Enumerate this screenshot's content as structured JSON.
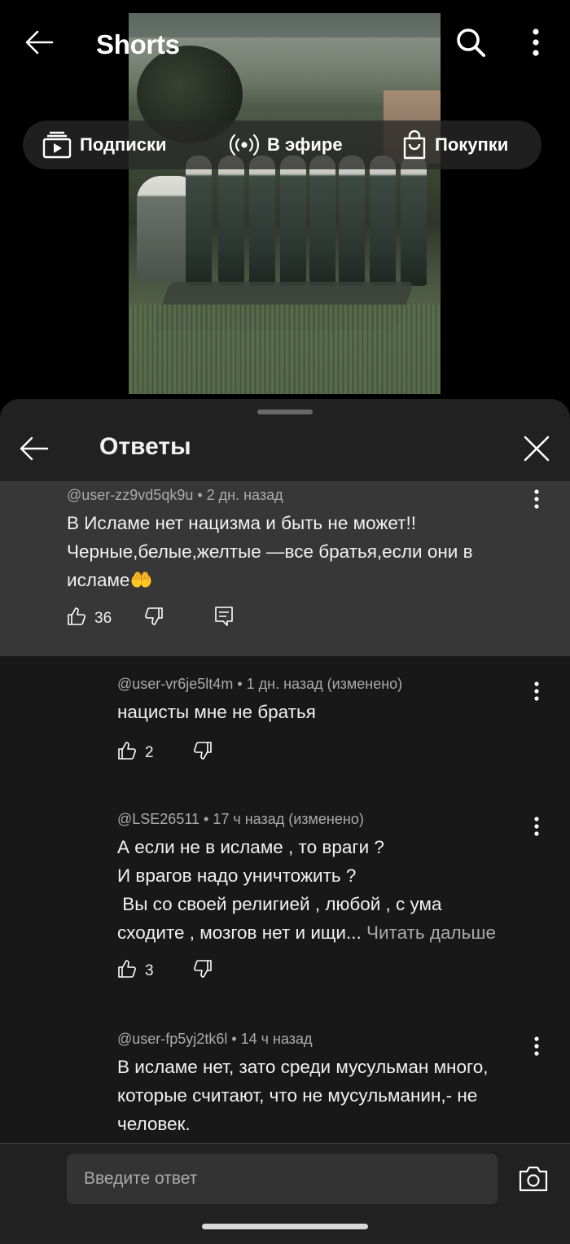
{
  "header": {
    "title": "Shorts",
    "back_icon": "arrow-back-icon",
    "search_icon": "search-icon",
    "more_icon": "more-vert-icon"
  },
  "chips": [
    {
      "label": "Подписки",
      "icon": "subscriptions-icon"
    },
    {
      "label": "В эфире",
      "icon": "live-icon"
    },
    {
      "label": "Покупки",
      "icon": "shopping-bag-icon"
    }
  ],
  "sheet": {
    "title": "Ответы",
    "back_icon": "arrow-back-icon",
    "close_icon": "close-icon"
  },
  "parent_comment": {
    "meta": "@user-zz9vd5qk9u • 2 дн. назад",
    "text": "В Исламе нет нацизма и быть не может!! Черные,белые,желтые —все братья,если они в исламе🤲",
    "likes": "36"
  },
  "replies": [
    {
      "meta": "@user-vr6je5lt4m • 1 дн. назад (изменено)",
      "text": "нацисты мне не братья",
      "likes": "2"
    },
    {
      "meta": "@LSE26511 • 17 ч назад (изменено)",
      "lines": [
        "А если не в исламе , то враги ?",
        "И врагов надо уничтожить ?",
        " Вы со своей религией , любой , с ума",
        "сходите , мозгов нет и ищи... "
      ],
      "read_more": "Читать дальше",
      "likes": "3"
    },
    {
      "meta": "@user-fp5yj2tk6l • 14 ч назад",
      "text": "В исламе нет, зато среди мусульман много, которые считают, что не мусульманин,- не человек."
    }
  ],
  "composer": {
    "placeholder": "Введите ответ",
    "camera_icon": "camera-icon"
  },
  "colors": {
    "background": "#000000",
    "sheet": "#212121",
    "highlight": "#373737",
    "list": "#181818",
    "text": "#f1f1f1",
    "secondary": "#aaaaaa"
  }
}
